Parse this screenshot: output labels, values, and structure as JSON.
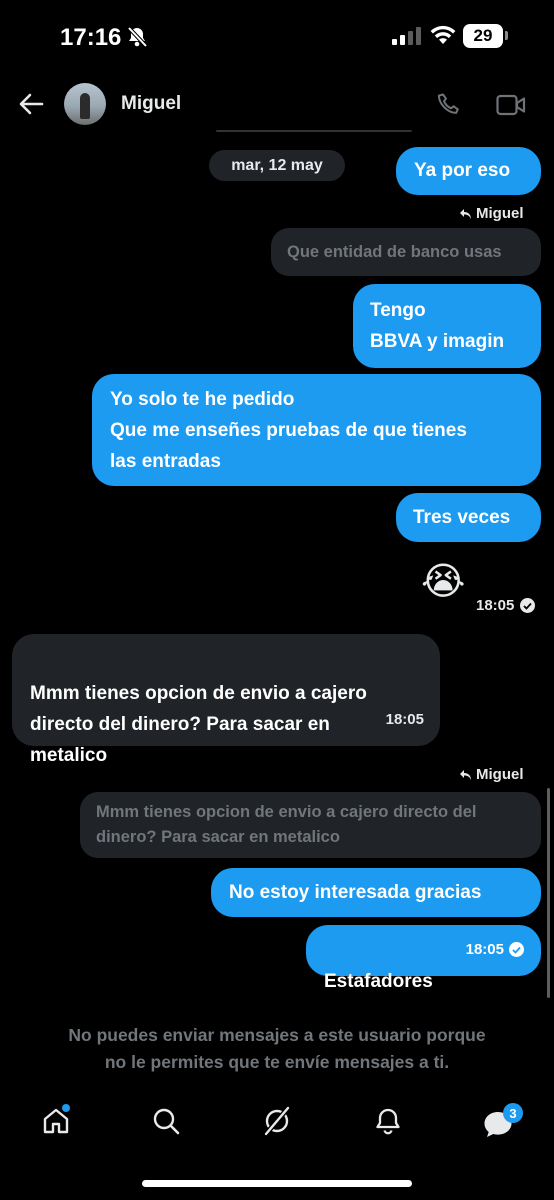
{
  "status_bar": {
    "time": "17:16",
    "battery": "29"
  },
  "header": {
    "contact_name": "Miguel"
  },
  "thread": {
    "date": "mar, 12 may",
    "msg_ya_por_eso": "Ya por eso",
    "reply_tag_1": "Miguel",
    "quote_1": "Que entidad de banco usas",
    "msg_tengo": "Tengo\nBBVA y imagin",
    "msg_solo": "Yo solo te he pedido\nQue me enseñes pruebas de que tienes\nlas  entradas",
    "msg_tres": "Tres veces",
    "emoji": "😭",
    "time_1": "18:05",
    "msg_in": "Mmm tienes opcion de envio a cajero\ndirecto del dinero? Para sacar en\nmetalico",
    "msg_in_time": "18:05",
    "reply_tag_2": "Miguel",
    "quote_2": "Mmm tienes opcion de envio a cajero directo del\ndinero? Para sacar en metalico",
    "msg_no_estoy": "No estoy interesada gracias",
    "msg_estafadores": "Estafadores",
    "msg_estafadores_time": "18:05"
  },
  "blocked_notice": "No puedes enviar mensajes a este usuario porque\nno le permites que te envíe mensajes a ti.",
  "nav": {
    "messages_badge": "3"
  },
  "colors": {
    "accent": "#1d9bf0",
    "incoming_bubble": "#202327",
    "background": "#000000"
  }
}
